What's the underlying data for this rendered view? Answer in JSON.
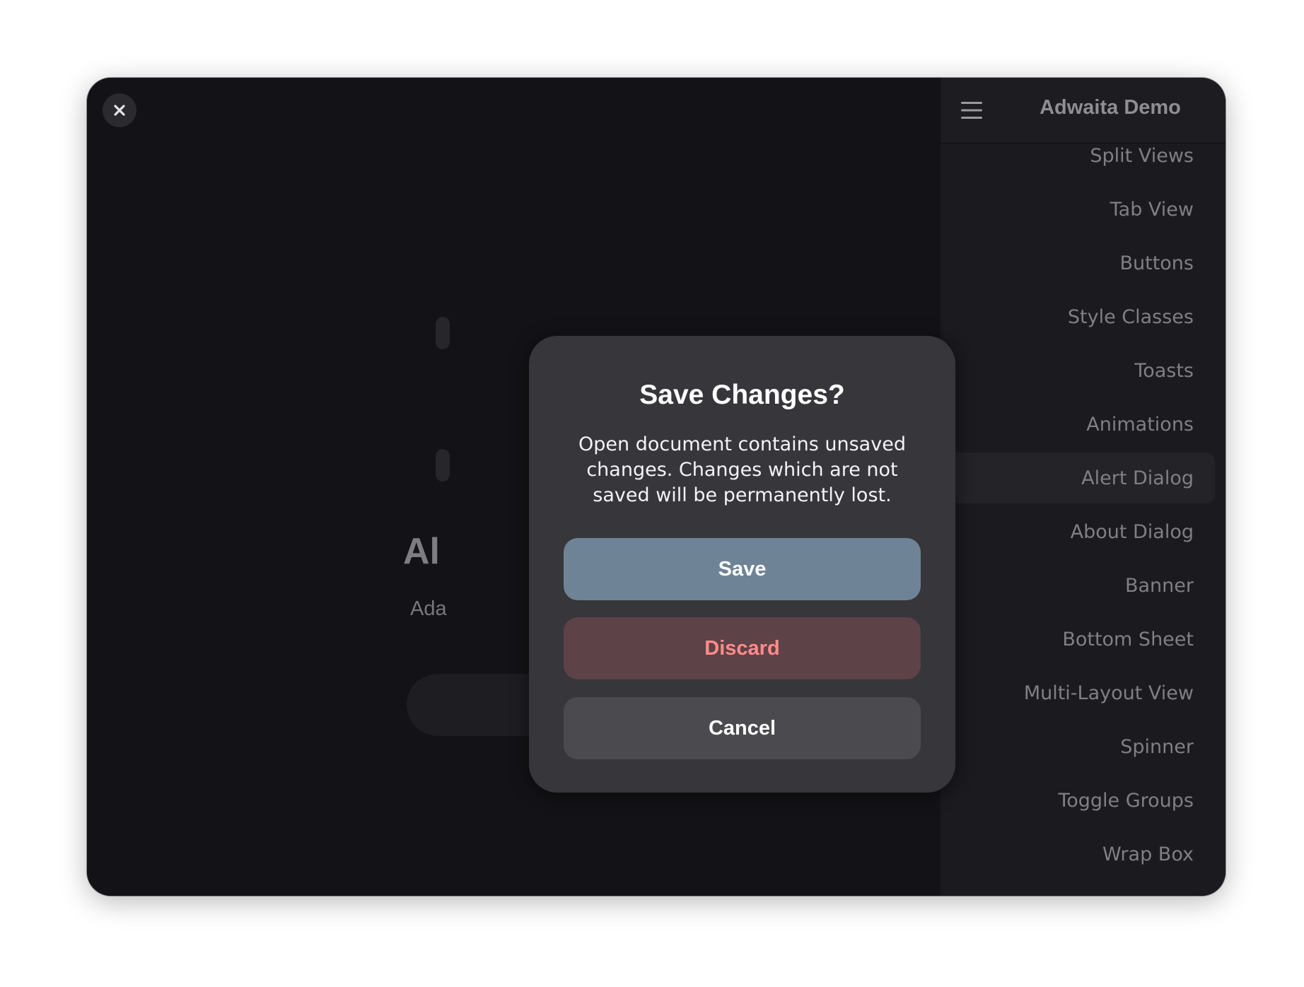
{
  "window": {
    "close_icon": "close-icon"
  },
  "background_page": {
    "title_fragment": "Al",
    "subtitle_fragment": "Ada"
  },
  "sidebar": {
    "menu_icon": "hamburger-menu-icon",
    "title": "Adwaita Demo",
    "items": [
      {
        "label": "Split Views",
        "active": false
      },
      {
        "label": "Tab View",
        "active": false
      },
      {
        "label": "Buttons",
        "active": false
      },
      {
        "label": "Style Classes",
        "active": false
      },
      {
        "label": "Toasts",
        "active": false
      },
      {
        "label": "Animations",
        "active": false
      },
      {
        "label": "Alert Dialog",
        "active": true
      },
      {
        "label": "About Dialog",
        "active": false
      },
      {
        "label": "Banner",
        "active": false
      },
      {
        "label": "Bottom Sheet",
        "active": false
      },
      {
        "label": "Multi-Layout View",
        "active": false
      },
      {
        "label": "Spinner",
        "active": false
      },
      {
        "label": "Toggle Groups",
        "active": false
      },
      {
        "label": "Wrap Box",
        "active": false
      }
    ]
  },
  "dialog": {
    "title": "Save Changes?",
    "body": "Open document contains unsaved changes. Changes which are not saved will be permanently lost.",
    "buttons": {
      "save": "Save",
      "discard": "Discard",
      "cancel": "Cancel"
    }
  },
  "colors": {
    "window_bg": "#131216",
    "sidebar_bg": "#1a1a1f",
    "dialog_bg": "#36363b",
    "suggested": "#6e8396",
    "destructive_bg": "#5d4247",
    "destructive_text": "#ff8c8c"
  }
}
